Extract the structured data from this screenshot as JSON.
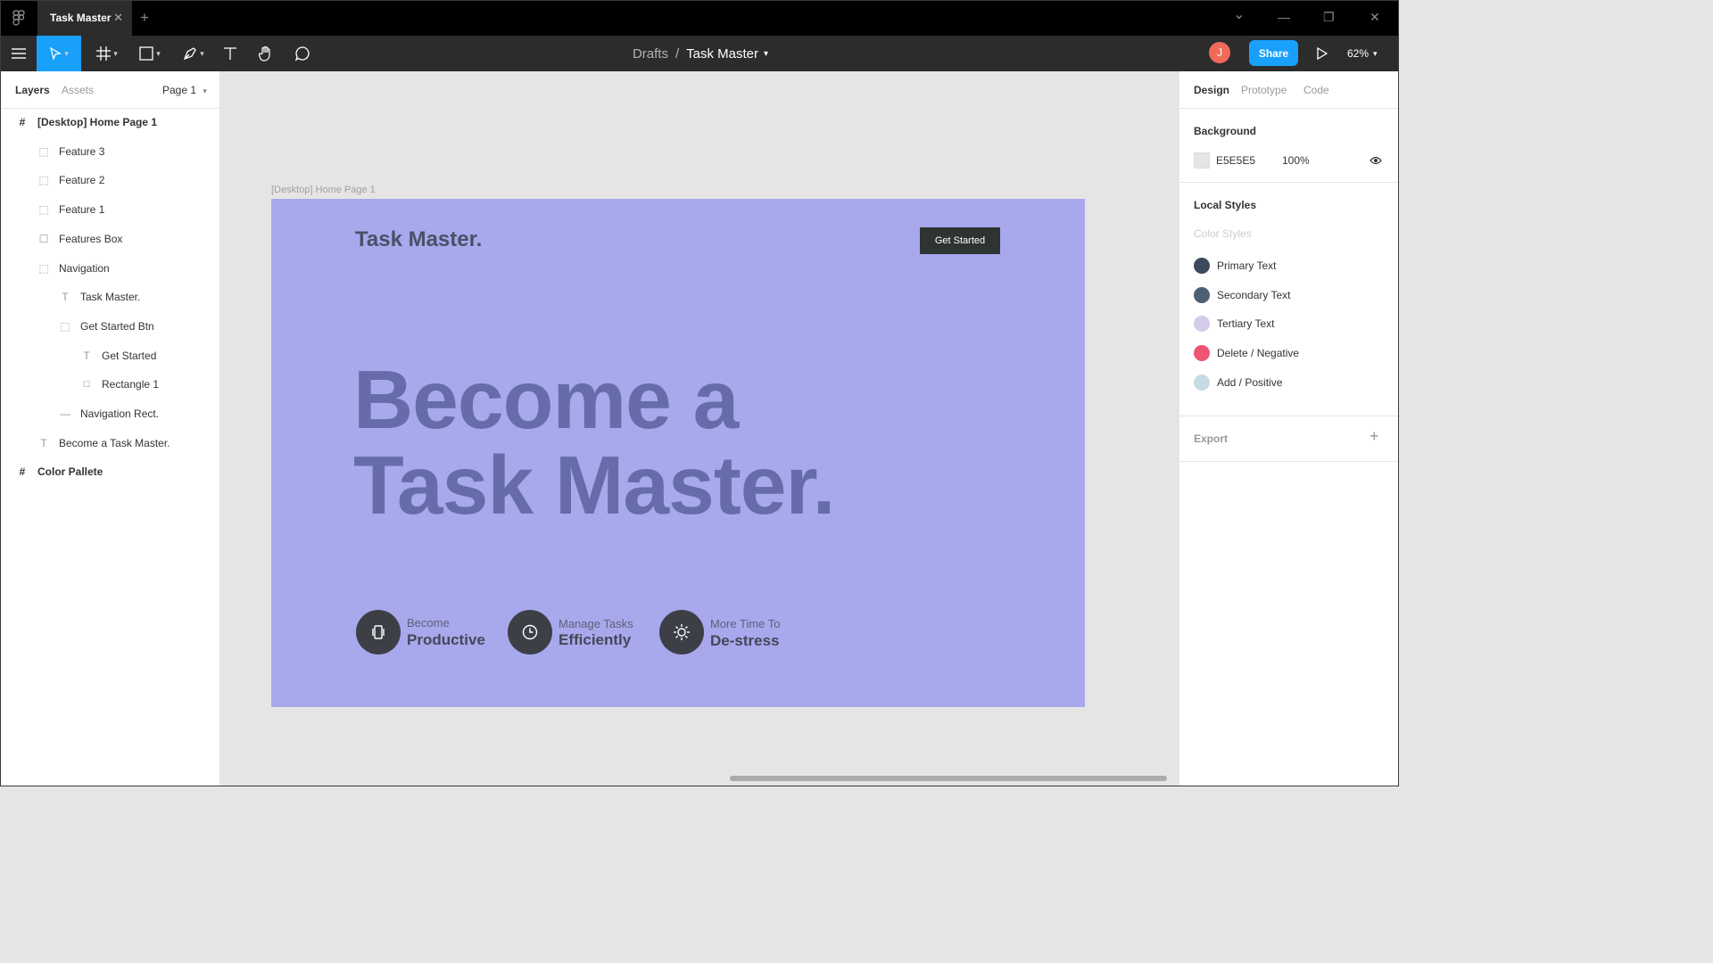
{
  "window": {
    "tab_title": "Task Master",
    "new_tab": "+",
    "close": "✕",
    "minimize": "—",
    "maximize": "❐",
    "dropdown": "⌄"
  },
  "toolbar": {
    "breadcrumb_parent": "Drafts",
    "breadcrumb_sep": "/",
    "file_name": "Task Master",
    "avatar_initial": "J",
    "share_label": "Share",
    "zoom": "62%"
  },
  "left_panel": {
    "tabs": {
      "layers": "Layers",
      "assets": "Assets",
      "page": "Page 1"
    },
    "layers": [
      {
        "label": "[Desktop] Home Page 1",
        "icon": "frame-icon"
      },
      {
        "label": "Feature 3",
        "icon": "group-icon"
      },
      {
        "label": "Feature 2",
        "icon": "group-icon"
      },
      {
        "label": "Feature 1",
        "icon": "group-icon"
      },
      {
        "label": "Features Box",
        "icon": "rectangle-icon"
      },
      {
        "label": "Navigation",
        "icon": "group-icon"
      },
      {
        "label": "Task Master.",
        "icon": "text-icon"
      },
      {
        "label": "Get Started Btn",
        "icon": "group-icon"
      },
      {
        "label": "Get Started",
        "icon": "text-icon"
      },
      {
        "label": "Rectangle 1",
        "icon": "rectangle-icon"
      },
      {
        "label": "Navigation Rect.",
        "icon": "line-icon"
      },
      {
        "label": "Become a Task Master.",
        "icon": "text-icon"
      },
      {
        "label": "Color Pallete",
        "icon": "frame-icon"
      }
    ]
  },
  "canvas": {
    "frame_label": "[Desktop] Home Page 1",
    "site_logo": "Task Master.",
    "site_cta": "Get Started",
    "hero_line1": "Become a",
    "hero_line2": "Task Master.",
    "features": [
      {
        "top": "Become",
        "bottom": "Productive",
        "icon": "phone-icon"
      },
      {
        "top": "Manage Tasks",
        "bottom": "Efficiently",
        "icon": "clock-icon"
      },
      {
        "top": "More Time To",
        "bottom": "De-stress",
        "icon": "sun-icon"
      }
    ],
    "frame_color": "#A8A8EC",
    "help": "?"
  },
  "right_panel": {
    "tabs": {
      "design": "Design",
      "prototype": "Prototype",
      "code": "Code"
    },
    "background_heading": "Background",
    "background_hex": "E5E5E5",
    "background_opacity": "100%",
    "local_styles_heading": "Local Styles",
    "color_styles_sub": "Color Styles",
    "styles": [
      {
        "name": "Primary Text",
        "color": "#3C4A5C"
      },
      {
        "name": "Secondary Text",
        "color": "#4F5F74"
      },
      {
        "name": "Tertiary Text",
        "color": "#D4CCEA"
      },
      {
        "name": "Delete / Negative",
        "color": "#EE5474"
      },
      {
        "name": "Add / Positive",
        "color": "#C5DCE5"
      }
    ],
    "export_heading": "Export",
    "export_add": "+"
  }
}
